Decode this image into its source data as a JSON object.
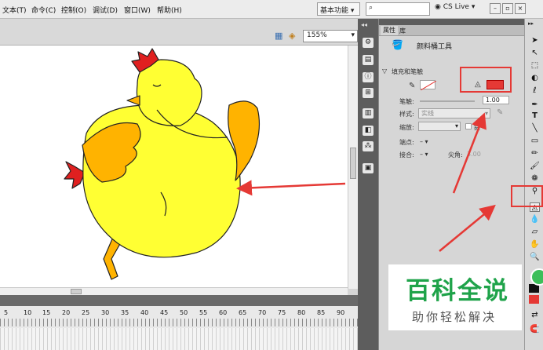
{
  "menubar": {
    "items": [
      "文本(T)",
      "命令(C)",
      "控制(O)",
      "调试(D)",
      "窗口(W)",
      "帮助(H)"
    ],
    "workspace": "基本功能",
    "cs_live": "CS Live"
  },
  "stage": {
    "zoom": "155%",
    "timeline_ticks": [
      "5",
      "10",
      "15",
      "20",
      "25",
      "30",
      "35",
      "40",
      "45",
      "50",
      "55",
      "60",
      "65",
      "70",
      "75",
      "80",
      "85",
      "90"
    ]
  },
  "panel": {
    "tabs": [
      "属性",
      "库"
    ],
    "tool_name": "颜料桶工具",
    "section": "填充和笔触",
    "stroke_label": "笔触:",
    "stroke_value": "1.00",
    "style_label": "样式:",
    "style_value": "实线",
    "scale_label": "缩放:",
    "hint_label": "提",
    "cap_label": "端点:",
    "join_label": "接合:",
    "miter_label": "尖角:",
    "miter_value": "3.00"
  },
  "colors": {
    "fill": "#e53935",
    "chicken_body": "#ffff33",
    "chicken_wing": "#ffb300",
    "comb": "#e02020",
    "annotation": "#e53935"
  },
  "watermark": {
    "title": "百科全说",
    "subtitle": "助你轻松解决"
  }
}
